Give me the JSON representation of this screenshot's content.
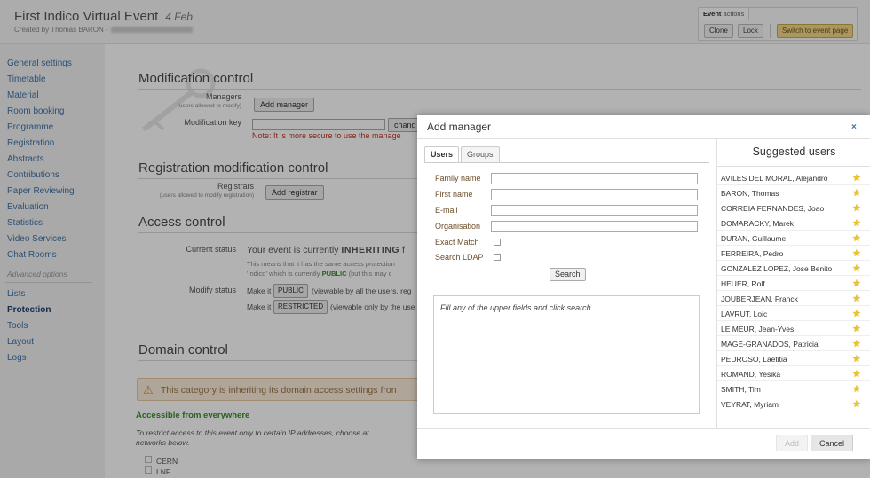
{
  "event": {
    "title": "First Indico Virtual Event",
    "date": "4 Feb",
    "created_by": "Created by Thomas BARON -"
  },
  "event_actions": {
    "label_bold": "Event",
    "label_rest": " actions",
    "clone": "Clone",
    "lock": "Lock",
    "switch": "Switch to event page"
  },
  "sidebar": {
    "items": [
      "General settings",
      "Timetable",
      "Material",
      "Room booking",
      "Programme",
      "Registration",
      "Abstracts",
      "Contributions",
      "Paper Reviewing",
      "Evaluation",
      "Statistics",
      "Video Services",
      "Chat Rooms"
    ],
    "advanced_label": "Advanced options",
    "advanced_items": [
      "Lists",
      "Protection",
      "Tools",
      "Layout",
      "Logs"
    ],
    "active": "Protection"
  },
  "modification": {
    "title": "Modification control",
    "managers_label": "Managers",
    "managers_sub": "(users allowed to modify)",
    "add_manager": "Add manager",
    "key_label": "Modification key",
    "change_btn": "chang",
    "note": "Note: It is more secure to use the manage"
  },
  "registration": {
    "title": "Registration modification control",
    "registrars_label": "Registrars",
    "registrars_sub": "(users allowed to modify registration)",
    "add_registrar": "Add registrar"
  },
  "access": {
    "title": "Access control",
    "current_status_label": "Current status",
    "status_text_a": "Your event is currently ",
    "status_text_b": "INHERITING",
    "status_text_c": " f",
    "means_line1": "This means that it has the same access protection",
    "means_line2a": "'Indico' which is currently ",
    "means_line2b": "PUBLIC",
    "means_line2c": " (but this may c",
    "modify_status_label": "Modify status",
    "make_it": "Make it",
    "public_btn": "PUBLIC",
    "public_desc": "(viewable by all the users, reg",
    "restricted_btn": "RESTRICTED",
    "restricted_desc": "(viewable only by the use"
  },
  "domain": {
    "title": "Domain control",
    "warning": "This category is inheriting its domain access settings fron",
    "accessible": "Accessible from everywhere",
    "restrict_line1": "To restrict access to this event only to certain IP addresses, choose at",
    "restrict_line2": "networks below.",
    "networks": [
      "CERN",
      "LNF"
    ]
  },
  "dialog": {
    "title": "Add manager",
    "close": "×",
    "tabs": [
      "Users",
      "Groups"
    ],
    "fields": [
      "Family name",
      "First name",
      "E-mail",
      "Organisation"
    ],
    "exact_match": "Exact Match",
    "search_ldap": "Search LDAP",
    "search_btn": "Search",
    "results_hint": "Fill any of the upper fields and click search...",
    "suggested_title": "Suggested users",
    "suggested": [
      "AVILES DEL MORAL, Alejandro",
      "BARON, Thomas",
      "CORREIA FERNANDES, Joao",
      "DOMARACKY, Marek",
      "DURAN, Guillaume",
      "FERREIRA, Pedro",
      "GONZALEZ LOPEZ, Jose Benito",
      "HEUER, Rolf",
      "JOUBERJEAN, Franck",
      "LAVRUT, Loic",
      "LE MEUR, Jean-Yves",
      "MAGE-GRANADOS, Patricia",
      "PEDROSO, Laetitia",
      "ROMAND, Yesika",
      "SMITH, Tim",
      "VEYRAT, Myriam"
    ],
    "add_btn": "Add",
    "cancel_btn": "Cancel"
  }
}
